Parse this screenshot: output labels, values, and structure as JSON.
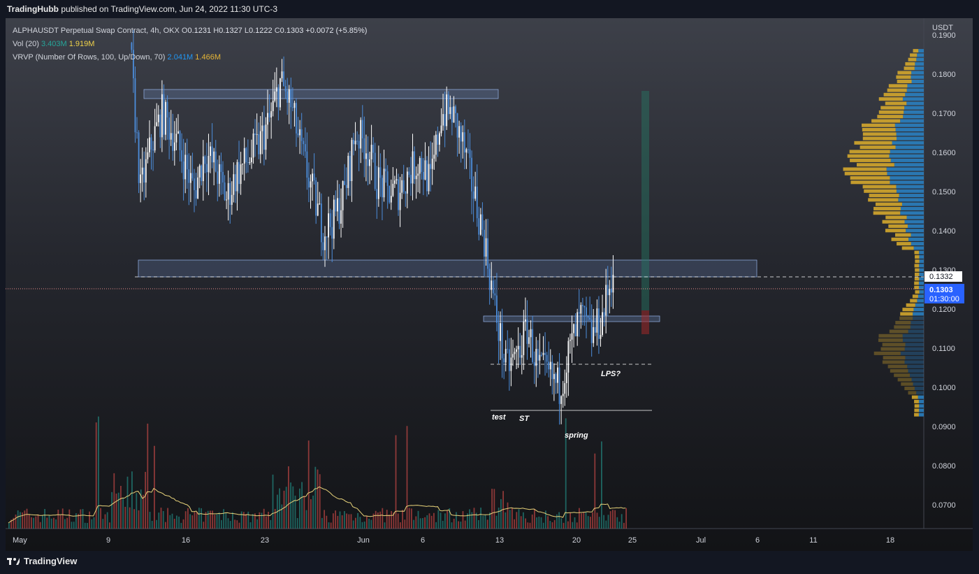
{
  "header": {
    "author": "TradingHubb",
    "published": "published on TradingView.com, Jun 24, 2022 11:30 UTC-3"
  },
  "legend": {
    "symbol": "ALPHAUSDT Perpetual Swap Contract, 4h, OKX",
    "o_label": "O",
    "o": "0.1231",
    "h_label": "H",
    "h": "0.1327",
    "l_label": "L",
    "l": "0.1222",
    "c_label": "C",
    "c": "0.1303",
    "change": "+0.0072 (+5.85%)",
    "vol_label": "Vol (20)",
    "vol1": "3.403M",
    "vol2": "1.919M",
    "vrvp_label": "VRVP (Number Of Rows, 100, Up/Down, 70)",
    "vrvp1": "2.041M",
    "vrvp2": "1.466M"
  },
  "footer": {
    "brand": "TradingView"
  },
  "colors": {
    "up": "#ffffff",
    "down": "#4c8ddb",
    "vol_ma": "#e8d37a",
    "vp_up": "#2a7fc0",
    "vp_down": "#d4a72c",
    "price_tag": "#2962ff"
  },
  "chart_data": {
    "type": "candlestick",
    "currency": "USDT",
    "ylim": [
      0.068,
      0.196
    ],
    "y_ticks": [
      "0.1900",
      "0.1800",
      "0.1700",
      "0.1600",
      "0.1500",
      "0.1400",
      "0.1300",
      "0.1200",
      "0.1100",
      "0.1000",
      "0.0900",
      "0.0800",
      "0.0700"
    ],
    "x_ticks": [
      "May",
      "9",
      "16",
      "23",
      "Jun",
      "6",
      "13",
      "20",
      "25",
      "Jul",
      "6",
      "11",
      "18"
    ],
    "price_labels": {
      "level": "0.1332",
      "last": "0.1303",
      "countdown": "01:30:00"
    },
    "annotations": [
      "test",
      "ST",
      "spring",
      "LPS?"
    ],
    "close_path": [
      [
        "2022-05-10",
        0.188
      ],
      [
        "2022-05-11",
        0.15
      ],
      [
        "2022-05-12",
        0.162
      ],
      [
        "2022-05-13",
        0.17
      ],
      [
        "2022-05-14",
        0.165
      ],
      [
        "2022-05-15",
        0.158
      ],
      [
        "2022-05-16",
        0.15
      ],
      [
        "2022-05-17",
        0.16
      ],
      [
        "2022-05-18",
        0.156
      ],
      [
        "2022-05-19",
        0.148
      ],
      [
        "2022-05-20",
        0.155
      ],
      [
        "2022-05-21",
        0.158
      ],
      [
        "2022-05-22",
        0.162
      ],
      [
        "2022-05-23",
        0.168
      ],
      [
        "2022-05-24",
        0.178
      ],
      [
        "2022-05-25",
        0.172
      ],
      [
        "2022-05-26",
        0.16
      ],
      [
        "2022-05-27",
        0.15
      ],
      [
        "2022-05-28",
        0.14
      ],
      [
        "2022-05-29",
        0.143
      ],
      [
        "2022-05-30",
        0.15
      ],
      [
        "2022-05-31",
        0.165
      ],
      [
        "2022-06-01",
        0.162
      ],
      [
        "2022-06-02",
        0.153
      ],
      [
        "2022-06-03",
        0.15
      ],
      [
        "2022-06-04",
        0.15
      ],
      [
        "2022-06-05",
        0.155
      ],
      [
        "2022-06-06",
        0.158
      ],
      [
        "2022-06-07",
        0.152
      ],
      [
        "2022-06-08",
        0.17
      ],
      [
        "2022-06-09",
        0.17
      ],
      [
        "2022-06-10",
        0.162
      ],
      [
        "2022-06-11",
        0.15
      ],
      [
        "2022-06-12",
        0.138
      ],
      [
        "2022-06-13",
        0.12
      ],
      [
        "2022-06-14",
        0.105
      ],
      [
        "2022-06-15",
        0.108
      ],
      [
        "2022-06-16",
        0.115
      ],
      [
        "2022-06-17",
        0.105
      ],
      [
        "2022-06-18",
        0.103
      ],
      [
        "2022-06-19",
        0.1
      ],
      [
        "2022-06-20",
        0.11
      ],
      [
        "2022-06-21",
        0.118
      ],
      [
        "2022-06-22",
        0.113
      ],
      [
        "2022-06-23",
        0.118
      ],
      [
        "2022-06-24",
        0.1303
      ]
    ]
  }
}
